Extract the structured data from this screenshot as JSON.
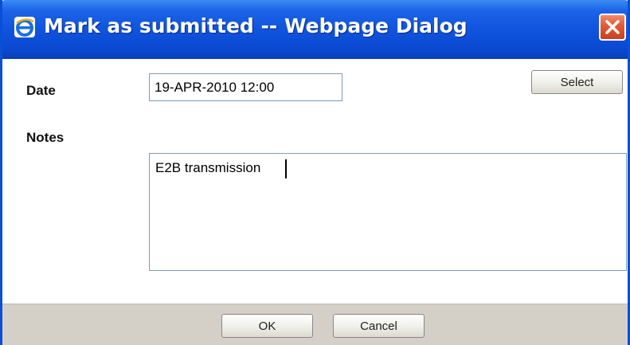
{
  "window": {
    "title": "Mark as submitted -- Webpage Dialog",
    "close_icon": "close-icon",
    "app_icon": "ie-icon"
  },
  "form": {
    "date_label": "Date",
    "date_value": "19-APR-2010 12:00",
    "select_label": "Select",
    "notes_label": "Notes",
    "notes_value": "E2B transmission"
  },
  "footer": {
    "ok_label": "OK",
    "cancel_label": "Cancel"
  },
  "colors": {
    "titlebar": "#0f52dc",
    "close_button": "#e15a34",
    "footer": "#d4d0c8",
    "input_border": "#7f9db9"
  }
}
